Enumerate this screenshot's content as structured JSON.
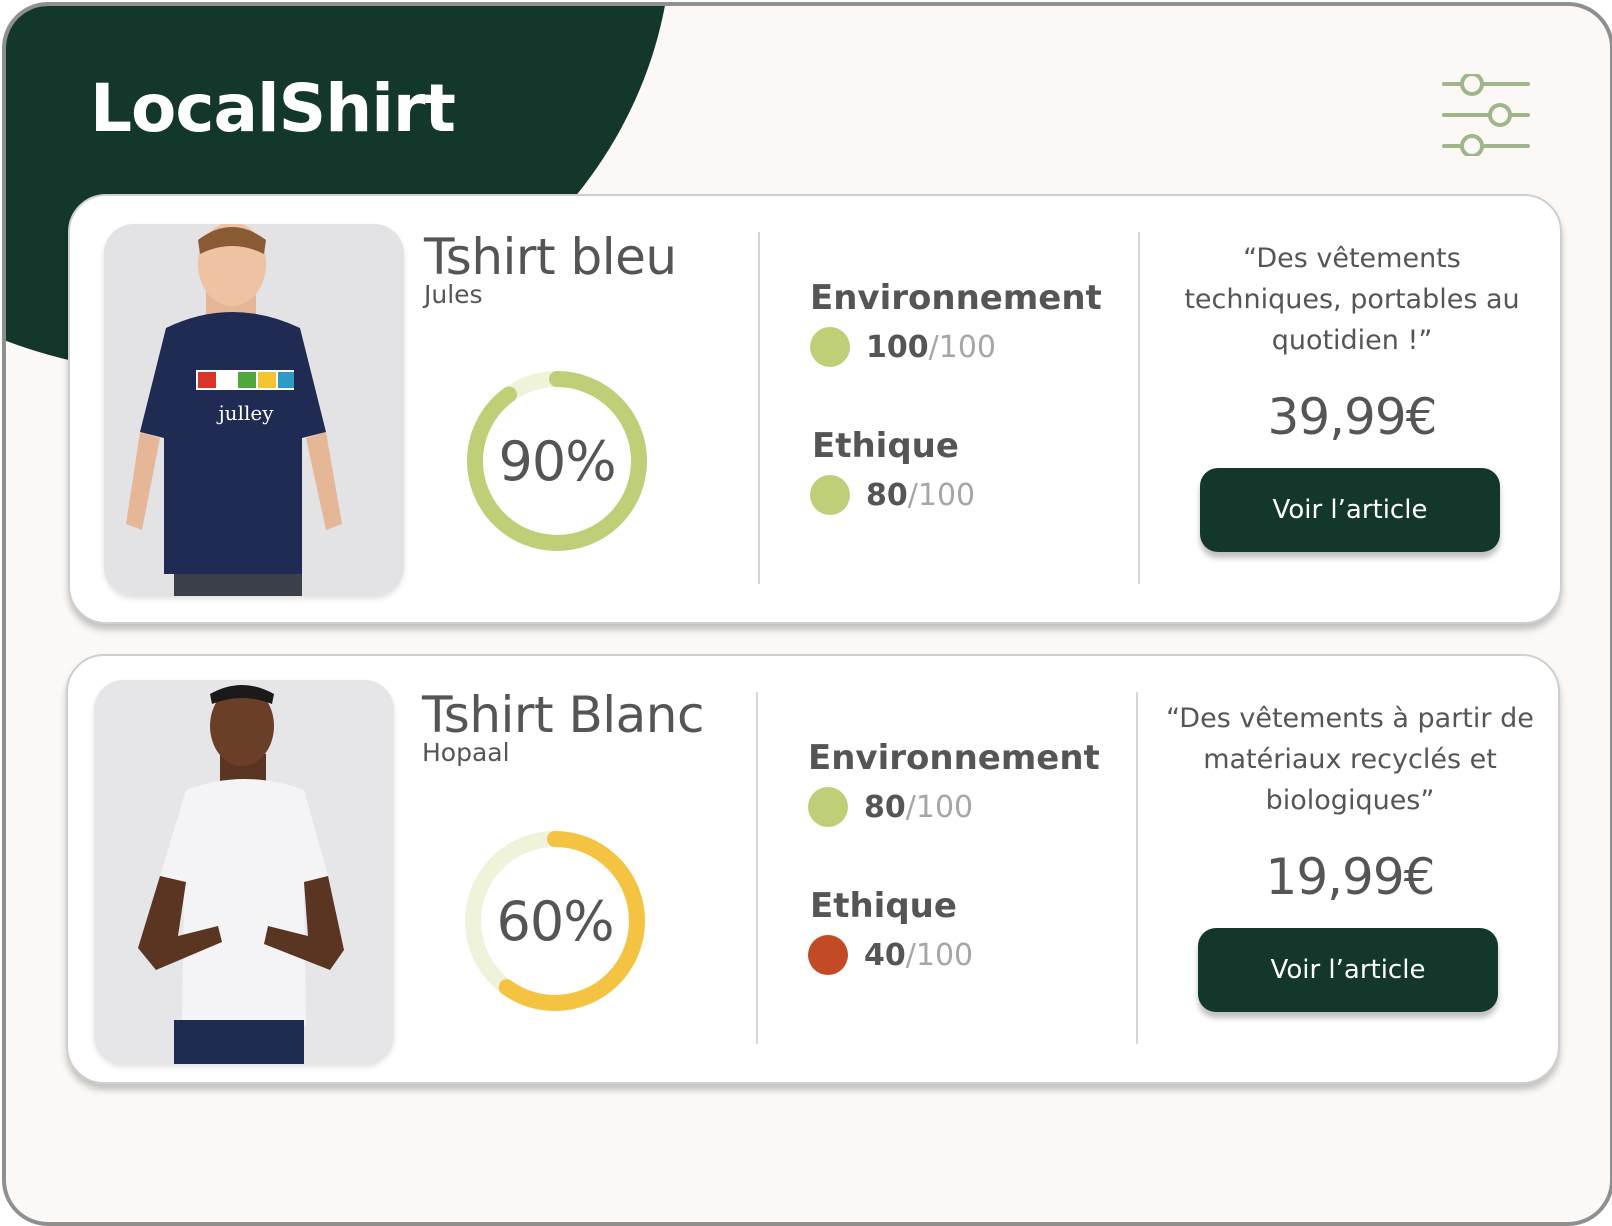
{
  "app": {
    "title": "LocalShirt"
  },
  "header": {
    "filter_icon": "sliders-icon"
  },
  "colors": {
    "brand_dark": "#13372b",
    "good": "#bfcf77",
    "warning": "#f4c342",
    "bad": "#c24a24",
    "track_light": "#eef3da"
  },
  "products": [
    {
      "name": "Tshirt bleu",
      "brand": "Jules",
      "score_percent": 90,
      "score_label": "90%",
      "ring_color": "#bfcf77",
      "environment": {
        "label": "Environnement",
        "score": "100",
        "out_of": "/100",
        "color": "#bfcf77"
      },
      "ethics": {
        "label": "Ethique",
        "score": "80",
        "out_of": "/100",
        "color": "#bfcf77"
      },
      "quote": "“Des vêtements techniques, portables au quotidien !”",
      "price": "39,99€",
      "button": "Voir l’article",
      "image": "navy-tshirt-photo"
    },
    {
      "name": "Tshirt Blanc",
      "brand": "Hopaal",
      "score_percent": 60,
      "score_label": "60%",
      "ring_color": "#f4c342",
      "environment": {
        "label": "Environnement",
        "score": "80",
        "out_of": "/100",
        "color": "#bfcf77"
      },
      "ethics": {
        "label": "Ethique",
        "score": "40",
        "out_of": "/100",
        "color": "#c24a24"
      },
      "quote": "“Des vêtements  à partir de matériaux recyclés et biologiques”",
      "price": "19,99€",
      "button": "Voir l’article",
      "image": "white-tshirt-photo"
    }
  ]
}
